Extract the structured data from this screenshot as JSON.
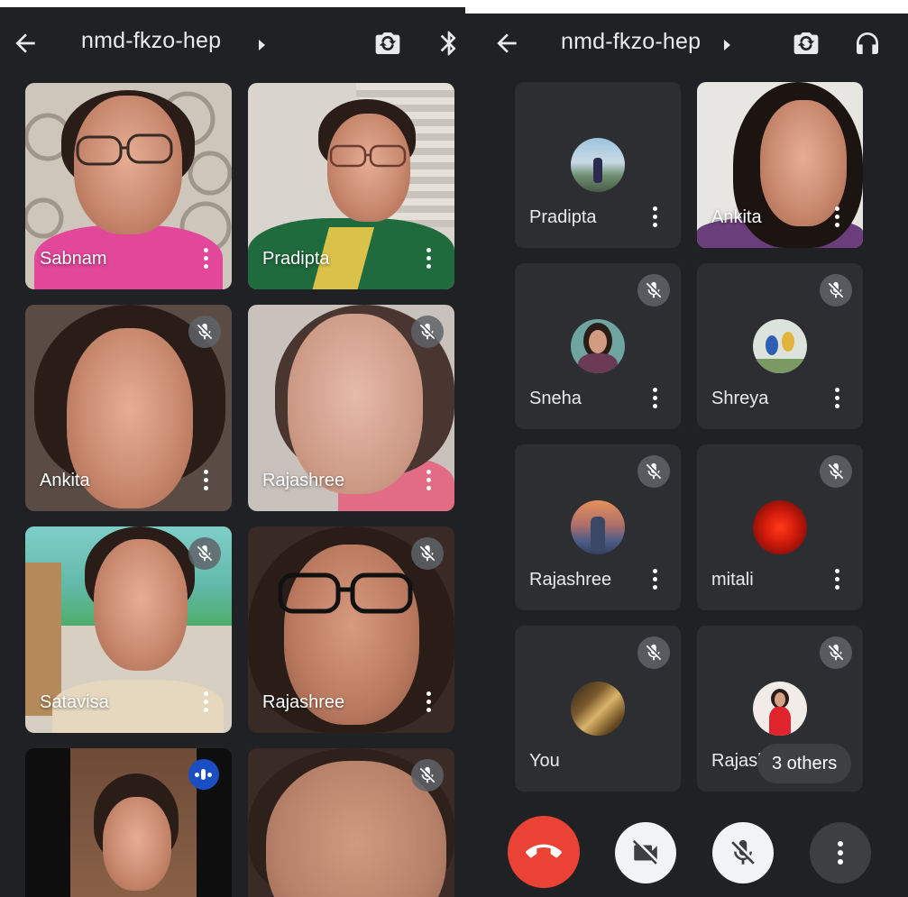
{
  "left_screen": {
    "meeting_title": "nmd-fkzo-hep",
    "tiles": [
      {
        "name": "Sabnam",
        "muted": false
      },
      {
        "name": "Pradipta",
        "muted": false
      },
      {
        "name": "Ankita",
        "muted": true
      },
      {
        "name": "Rajashree",
        "muted": true
      },
      {
        "name": "Satavisa",
        "muted": true
      },
      {
        "name": "Rajashree",
        "muted": true
      },
      {
        "name": "",
        "speaking": true
      },
      {
        "name": "",
        "muted": true
      }
    ]
  },
  "right_screen": {
    "meeting_title": "nmd-fkzo-hep",
    "tiles": [
      {
        "name": "Pradipta",
        "muted": false,
        "avatar": "landscape-photo"
      },
      {
        "name": "Ankita",
        "muted": false,
        "video": true
      },
      {
        "name": "Sneha",
        "muted": true,
        "avatar": "portrait-photo"
      },
      {
        "name": "Shreya",
        "muted": true,
        "avatar": "birds-photo"
      },
      {
        "name": "Rajashree",
        "muted": true,
        "avatar": "statue-sunset-photo"
      },
      {
        "name": "mitali",
        "muted": true,
        "avatar": "red-flower-photo"
      },
      {
        "name": "You",
        "muted": true,
        "avatar": "gold-abstract-photo"
      },
      {
        "name": "Rajash",
        "muted": true,
        "avatar": "girl-red-dress-photo"
      }
    ],
    "others_label": "3 others",
    "controls": [
      "end-call",
      "camera-off",
      "mic-off",
      "more-options"
    ]
  },
  "colors": {
    "background": "#202124",
    "tile": "#2d2e31",
    "end_call": "#ea4335",
    "speaking": "#1a4fc4"
  }
}
